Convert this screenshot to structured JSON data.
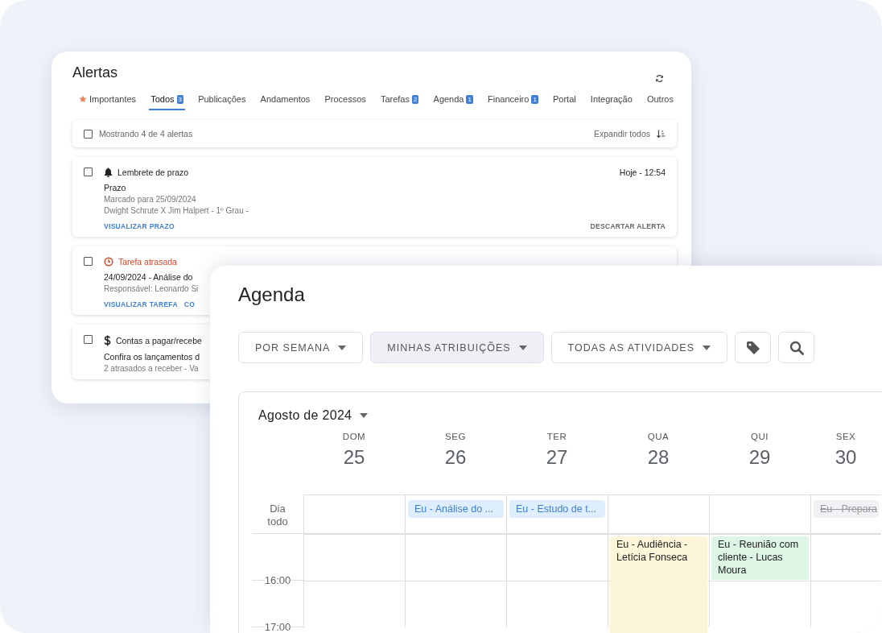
{
  "alerts_panel": {
    "title": "Alertas",
    "tabs": [
      {
        "label": "Importantes",
        "kind": "starred",
        "selected": false
      },
      {
        "label": "Todos",
        "kind": "plain",
        "badge": "3",
        "selected": true
      },
      {
        "label": "Publicações",
        "kind": "plain",
        "selected": false
      },
      {
        "label": "Andamentos",
        "kind": "plain",
        "selected": false
      },
      {
        "label": "Processos",
        "kind": "plain",
        "selected": false
      },
      {
        "label": "Tarefas",
        "kind": "plain",
        "badge": "2",
        "selected": false
      },
      {
        "label": "Agenda",
        "kind": "plain",
        "badge": "1",
        "selected": false
      },
      {
        "label": "Financeiro",
        "kind": "plain",
        "badge": "1",
        "selected": false
      },
      {
        "label": "Portal",
        "kind": "plain",
        "selected": false
      },
      {
        "label": "Integração",
        "kind": "plain",
        "selected": false
      },
      {
        "label": "Outros",
        "kind": "plain",
        "selected": false
      }
    ],
    "list_header": {
      "checked": false,
      "summary": "Mostrando 4 de 4 alertas",
      "expand_all": "Expandir todos"
    },
    "alerts": [
      {
        "kind": "reminder",
        "checked": false,
        "title": "Lembrete de prazo",
        "time": "Hoje - 12:54",
        "lines": [
          "Prazo",
          "Marcado para 25/09/2024",
          "Dwight Schrute X Jim Halpert - 1º Grau -"
        ],
        "actions": [
          {
            "label": "VISUALIZAR PRAZO",
            "kind": "link"
          },
          {
            "label": "DESCARTAR ALERTA",
            "kind": "dismiss"
          }
        ]
      },
      {
        "kind": "overdue",
        "checked": false,
        "title": "Tarefa atrasada",
        "lines": [
          "24/09/2024 - Análise do",
          "Responsável: Leonardo Si"
        ],
        "actions": [
          {
            "label": "VISUALIZAR TAREFA",
            "kind": "link"
          },
          {
            "label": "CO",
            "kind": "link"
          }
        ]
      },
      {
        "kind": "finance",
        "checked": false,
        "title": "Contas a pagar/recebe",
        "lines": [
          "Confira os lançamentos d",
          "2 atrasados a receber - Va"
        ]
      }
    ]
  },
  "agenda_panel": {
    "title": "Agenda",
    "filters": [
      {
        "label": "POR SEMANA",
        "selected": false
      },
      {
        "label": "MINHAS ATRIBUIÇÕES",
        "selected": true
      },
      {
        "label": "TODAS AS ATIVIDADES",
        "selected": false
      }
    ],
    "calendar": {
      "month": "Agosto de 2024",
      "all_day_label": "Dia todo",
      "time_labels": [
        "16:00",
        "17:00"
      ],
      "days": [
        {
          "weekday": "DOM",
          "date": "25"
        },
        {
          "weekday": "SEG",
          "date": "26",
          "all_day": [
            {
              "text": "Eu - Análise do ...",
              "color": "#dfeefc",
              "done": false
            }
          ]
        },
        {
          "weekday": "TER",
          "date": "27",
          "all_day": [
            {
              "text": "Eu - Estudo de t...",
              "color": "#dfeefc",
              "done": false
            }
          ]
        },
        {
          "weekday": "QUA",
          "date": "28",
          "events": [
            {
              "text": "Eu - Audiência - Letícia Fonseca",
              "color": "#fdf5d9",
              "kind": "long"
            }
          ]
        },
        {
          "weekday": "QUI",
          "date": "29",
          "events": [
            {
              "text": "Eu - Reunião com cliente - Lucas Moura",
              "color": "#dcf5e5",
              "kind": "short"
            }
          ]
        },
        {
          "weekday": "SEX",
          "date": "30",
          "all_day": [
            {
              "text": "Eu - Prepara",
              "color": "#f0f1f4",
              "done": true
            }
          ]
        }
      ]
    }
  }
}
